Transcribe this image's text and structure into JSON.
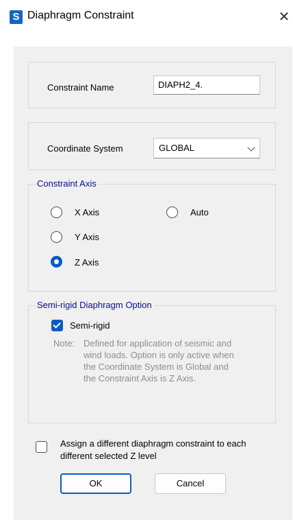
{
  "window": {
    "title": "Diaphragm Constraint",
    "app_icon_letter": "S",
    "close_glyph": "✕"
  },
  "constraint_name": {
    "label": "Constraint Name",
    "value": "DIAPH2_4."
  },
  "coordinate_system": {
    "label": "Coordinate System",
    "selected": "GLOBAL"
  },
  "constraint_axis": {
    "legend": "Constraint Axis",
    "options": [
      {
        "label": "X Axis",
        "checked": false
      },
      {
        "label": "Y Axis",
        "checked": false
      },
      {
        "label": "Z Axis",
        "checked": true
      },
      {
        "label": "Auto",
        "checked": false
      }
    ]
  },
  "semi_rigid": {
    "legend": "Semi-rigid Diaphragm Option",
    "checkbox_label": "Semi-rigid",
    "checked": true,
    "note_label": "Note:",
    "note_text": "Defined for application of seismic and wind loads. Option is only active when the Coordinate System is Global and the Constraint Axis is Z Axis."
  },
  "assign_option": {
    "label": "Assign a different diaphragm constraint to each different selected Z level",
    "checked": false
  },
  "buttons": {
    "ok": "OK",
    "cancel": "Cancel"
  },
  "colors": {
    "accent": "#0a5bc4",
    "legend_text": "#0b0b8f",
    "dialog_bg": "#f0f0f0",
    "note_text": "#8d8d8d"
  }
}
